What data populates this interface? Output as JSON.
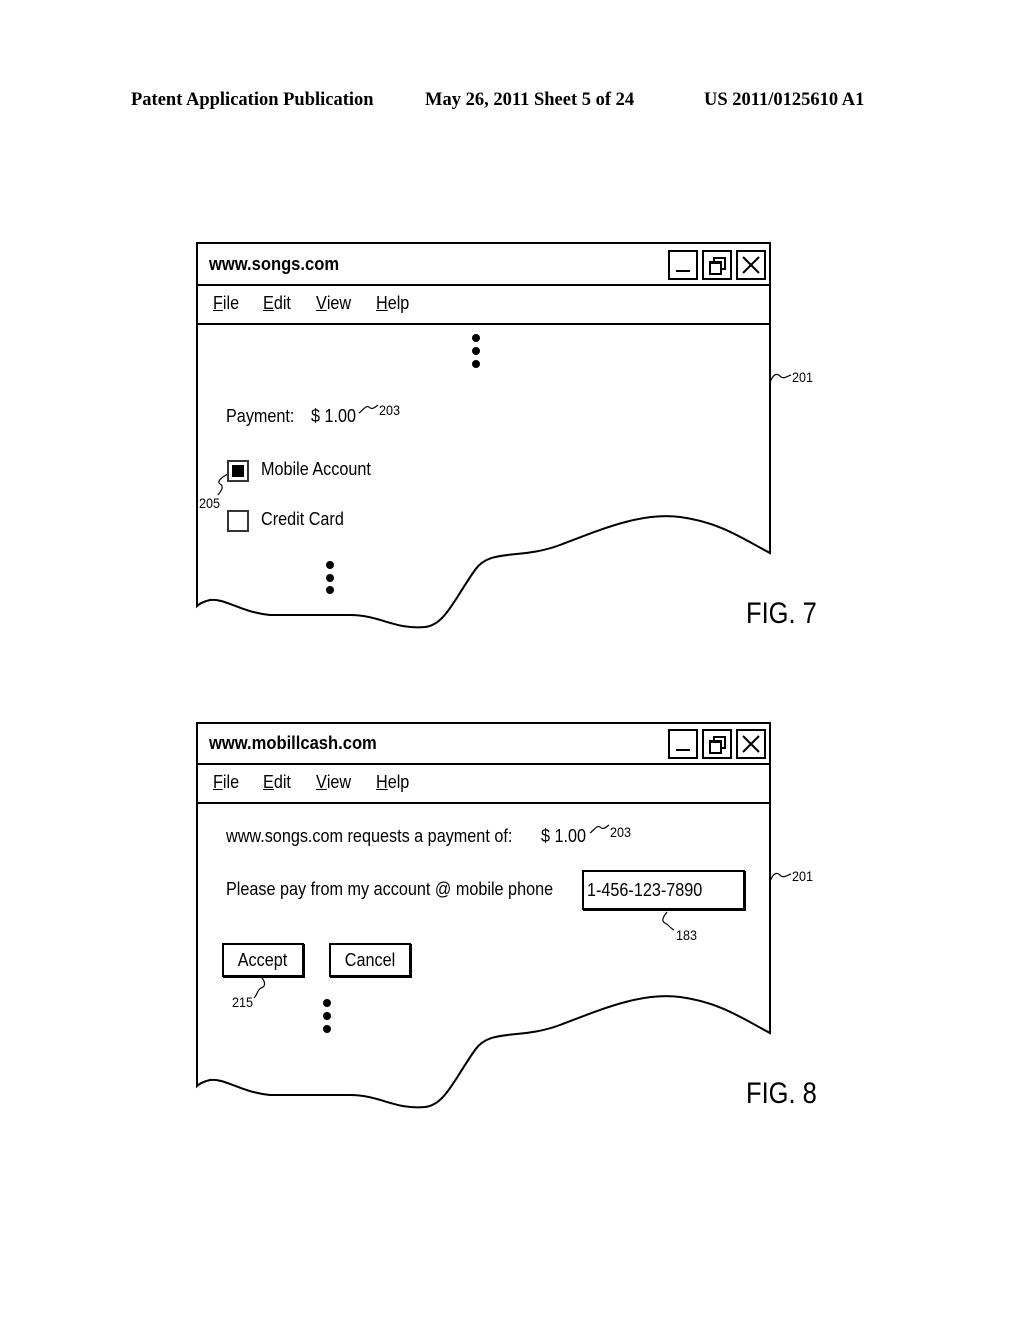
{
  "header": {
    "publication": "Patent Application Publication",
    "date_sheet": "May 26, 2011  Sheet 5 of 24",
    "number": "US 2011/0125610 A1"
  },
  "fig7": {
    "window_title": "www.songs.com",
    "menu": [
      {
        "first": "F",
        "rest": "ile"
      },
      {
        "first": "E",
        "rest": "dit"
      },
      {
        "first": "V",
        "rest": "iew"
      },
      {
        "first": "H",
        "rest": "elp"
      }
    ],
    "payment_label": "Payment:",
    "payment_amount": "$ 1.00",
    "ref_payment": "203",
    "ref_window": "201",
    "ref_checkbox": "205",
    "options": [
      {
        "label": "Mobile Account",
        "checked": true
      },
      {
        "label": "Credit Card",
        "checked": false
      }
    ],
    "caption": "FIG. 7",
    "window_icons": [
      "minimize-icon",
      "restore-icon",
      "close-icon"
    ]
  },
  "fig8": {
    "window_title": "www.mobillcash.com",
    "menu": [
      {
        "first": "F",
        "rest": "ile"
      },
      {
        "first": "E",
        "rest": "dit"
      },
      {
        "first": "V",
        "rest": "iew"
      },
      {
        "first": "H",
        "rest": "elp"
      }
    ],
    "request_text": "www.songs.com requests a payment of:",
    "payment_amount": "$ 1.00",
    "ref_payment": "203",
    "ref_window": "201",
    "pay_from_label": "Please pay from my account @ mobile phone",
    "phone_value": "1-456-123-7890",
    "ref_phone": "183",
    "accept_label": "Accept",
    "cancel_label": "Cancel",
    "ref_accept": "215",
    "caption": "FIG. 8",
    "window_icons": [
      "minimize-icon",
      "restore-icon",
      "close-icon"
    ]
  }
}
